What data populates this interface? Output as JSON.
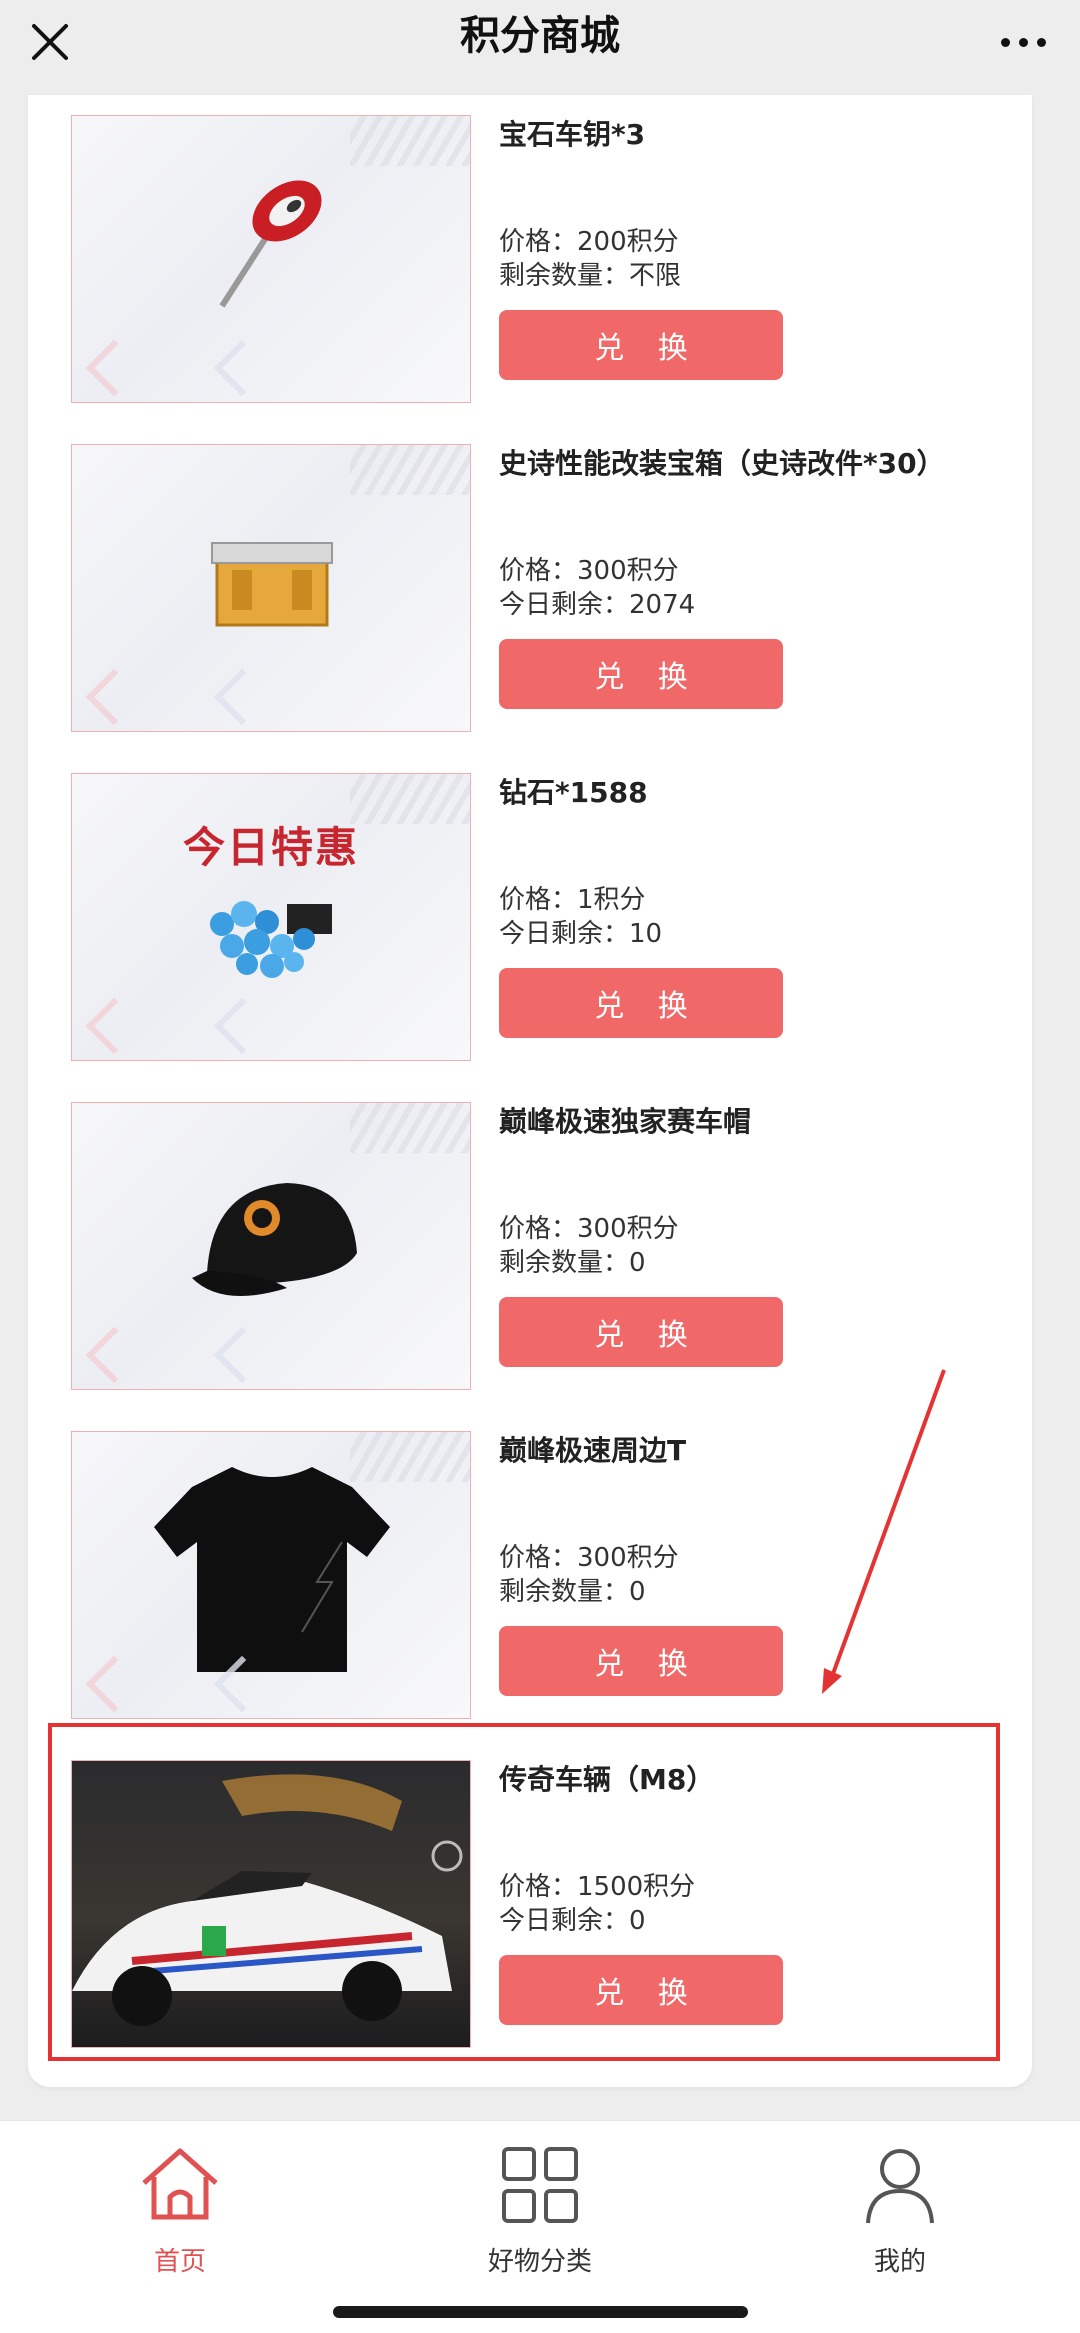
{
  "header": {
    "title": "积分商城"
  },
  "promo_banner_text": "今日特惠",
  "redeem_label": "兑 换",
  "products": [
    {
      "name": "宝石车钥*3",
      "price": "价格：200积分",
      "stock": "剩余数量：不限",
      "image": "gem-car-key-image"
    },
    {
      "name": "史诗性能改装宝箱（史诗改件*30）",
      "price": "价格：300积分",
      "stock": "今日剩余：2074",
      "image": "epic-crate-image"
    },
    {
      "name": "钻石*1588",
      "price": "价格：1积分",
      "stock": "今日剩余：10",
      "image": "diamonds-image"
    },
    {
      "name": "巅峰极速独家赛车帽",
      "price": "价格：300积分",
      "stock": "剩余数量：0",
      "image": "racing-cap-image"
    },
    {
      "name": "巅峰极速周边T",
      "price": "价格：300积分",
      "stock": "剩余数量：0",
      "image": "tshirt-image"
    },
    {
      "name": "传奇车辆（M8）",
      "price": "价格：1500积分",
      "stock": "今日剩余：0",
      "image": "m8-car-image"
    }
  ],
  "tabbar": {
    "items": [
      {
        "label": "首页",
        "icon": "home-icon",
        "active": true
      },
      {
        "label": "好物分类",
        "icon": "category-grid-icon",
        "active": false
      },
      {
        "label": "我的",
        "icon": "profile-icon",
        "active": false
      }
    ]
  },
  "colors": {
    "accent": "#f06868",
    "highlight": "#e53333",
    "active_tab": "#e05252"
  }
}
